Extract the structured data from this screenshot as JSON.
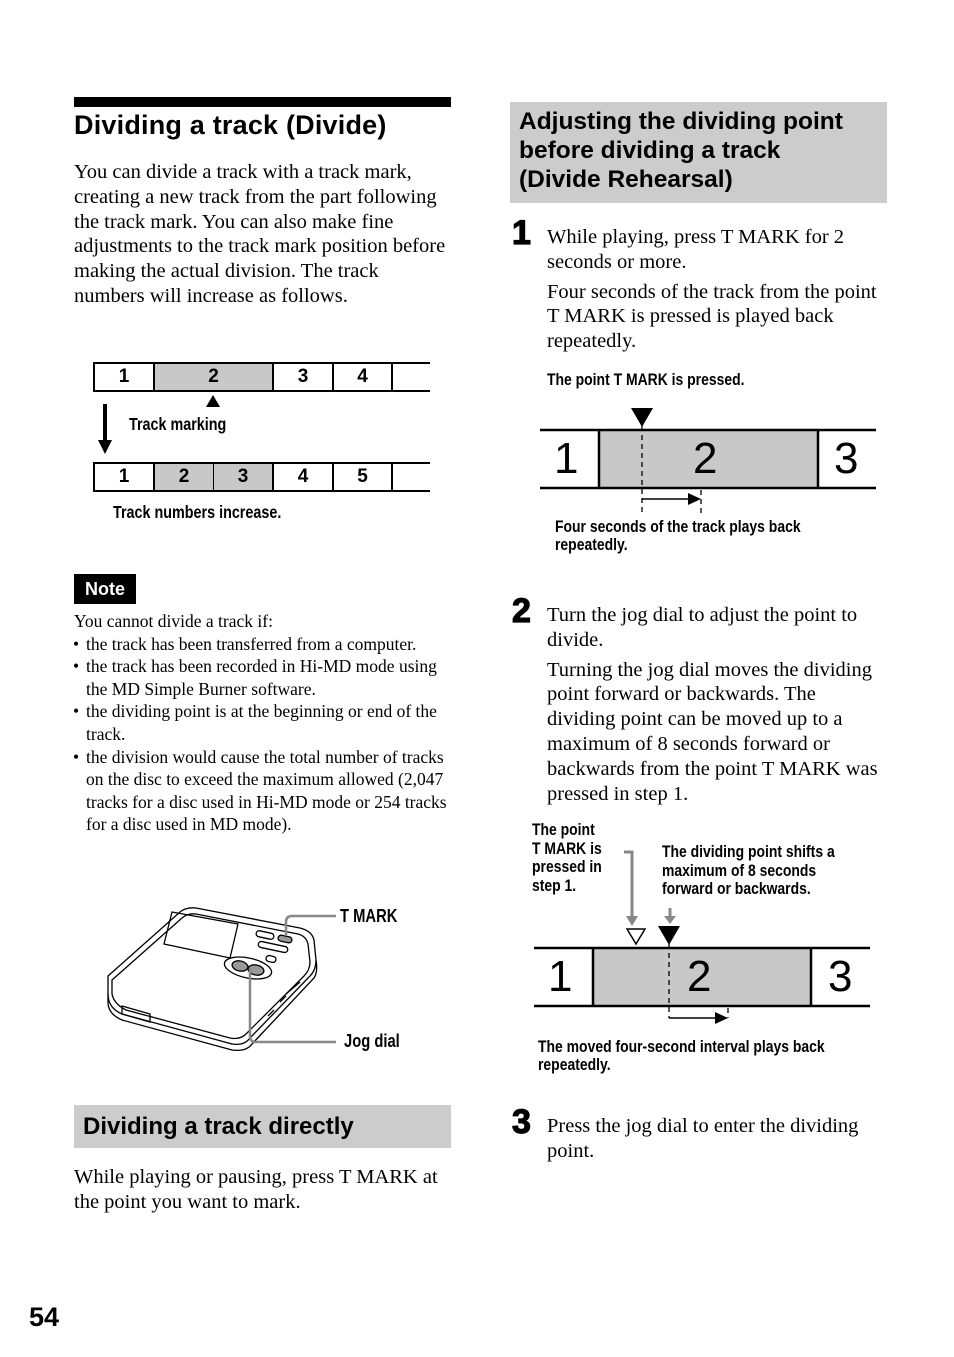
{
  "page_number": "54",
  "left_column": {
    "title": "Dividing a track (Divide)",
    "intro": "You can divide a track with a track mark, creating a new track from the part following the track mark. You can also make fine adjustments to the track mark position before making the actual division. The track numbers will increase as follows.",
    "track_diagram": {
      "before_tracks": [
        "1",
        "2",
        "3",
        "4",
        ""
      ],
      "before_selected_index": 1,
      "after_tracks": [
        "1",
        "2",
        "3",
        "4",
        "5",
        ""
      ],
      "after_selected_indices": [
        1,
        2
      ],
      "track_marking_label": "Track marking",
      "result_label": "Track numbers increase."
    },
    "note": {
      "badge": "Note",
      "lead": "You cannot divide a track if:",
      "items": [
        "the track has been transferred from a computer.",
        "the track has been recorded in Hi-MD mode using the MD Simple Burner software.",
        "the dividing point is at the beginning or end of the track.",
        "the division would cause the total number of tracks on the disc to exceed the maximum allowed (2,047 tracks for a disc used in Hi-MD mode or 254 tracks for a disc used in MD mode)."
      ]
    },
    "device_illustration": {
      "tmark_label": "T MARK",
      "jog_label": "Jog dial"
    },
    "direct": {
      "heading": "Dividing a track directly",
      "body": "While playing or pausing, press T MARK at the point you want to mark."
    }
  },
  "right_column": {
    "heading_lines": [
      "Adjusting the dividing point",
      "before dividing a track",
      "(Divide Rehearsal)"
    ],
    "steps": [
      {
        "number": "1",
        "paragraphs": [
          "While playing, press T MARK for 2 seconds or more.",
          "Four seconds of the track from the point T MARK is pressed is played back repeatedly."
        ]
      },
      {
        "number": "2",
        "paragraphs": [
          "Turn the jog dial to adjust the point to divide.",
          "Turning the jog dial moves the dividing point forward or backwards. The dividing point can be moved up to a maximum of 8 seconds forward or backwards from the point T MARK was pressed in step 1."
        ]
      },
      {
        "number": "3",
        "paragraphs": [
          "Press the jog dial to enter the dividing point."
        ]
      }
    ],
    "diagram1": {
      "top_label": "The point T MARK is pressed.",
      "tracks": [
        "1",
        "2",
        "3"
      ],
      "bottom_label_lines": [
        "Four seconds of the track plays back",
        "repeatedly."
      ]
    },
    "diagram2": {
      "left_label_lines": [
        "The point",
        "T MARK is",
        "pressed in",
        "step 1."
      ],
      "right_label_lines": [
        "The dividing point shifts a",
        "maximum of 8 seconds",
        "forward or backwards."
      ],
      "tracks": [
        "1",
        "2",
        "3"
      ],
      "bottom_label_lines": [
        "The moved four-second interval plays back",
        "repeatedly."
      ]
    }
  }
}
